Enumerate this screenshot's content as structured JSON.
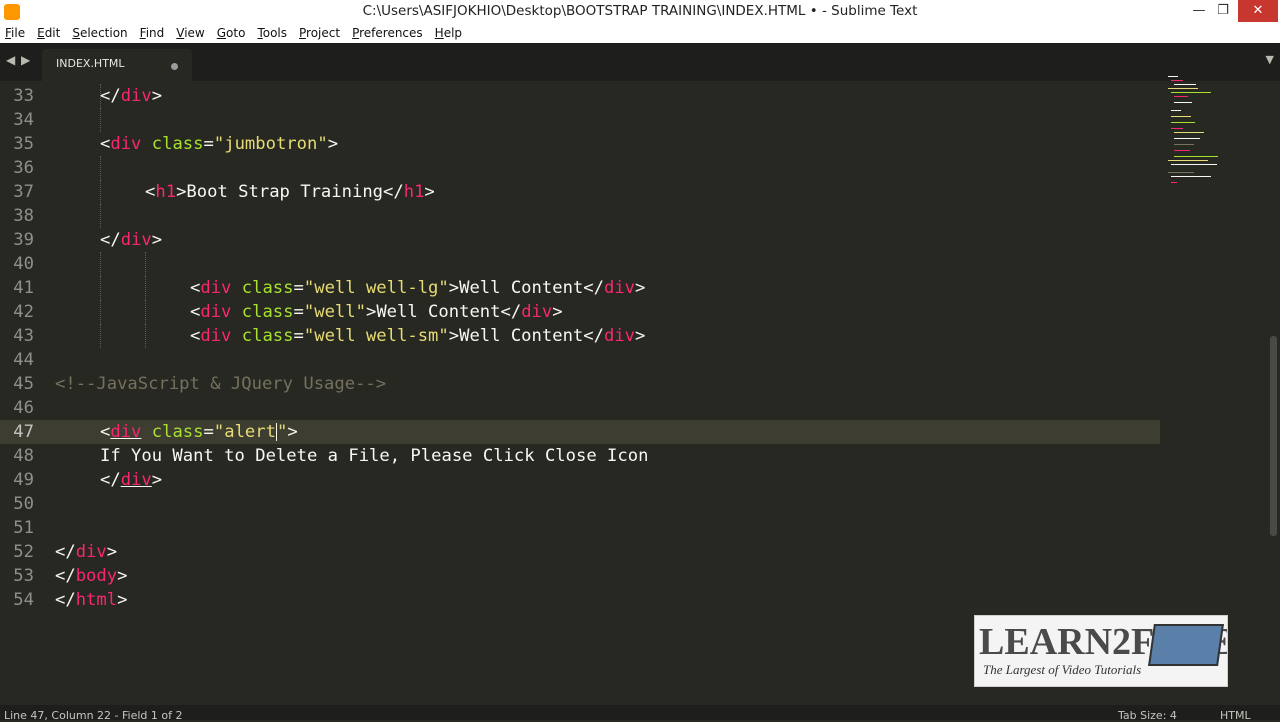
{
  "window": {
    "title": "C:\\Users\\ASIFJOKHIO\\Desktop\\BOOTSTRAP TRAINING\\INDEX.HTML • - Sublime Text",
    "controls": {
      "minimize": "—",
      "maximize": "❐",
      "close": "✕"
    }
  },
  "menu": [
    {
      "ul": "F",
      "rest": "ile"
    },
    {
      "ul": "E",
      "rest": "dit"
    },
    {
      "ul": "S",
      "rest": "election"
    },
    {
      "ul": "F",
      "rest": "ind"
    },
    {
      "ul": "V",
      "rest": "iew"
    },
    {
      "ul": "G",
      "rest": "oto"
    },
    {
      "ul": "T",
      "rest": "ools"
    },
    {
      "ul": "P",
      "rest": "roject"
    },
    {
      "ul": "P",
      "rest": "references"
    },
    {
      "ul": "H",
      "rest": "elp"
    }
  ],
  "tabs": {
    "nav_left": "◀",
    "nav_right": "▶",
    "overflow": "▼",
    "items": [
      {
        "label": "INDEX.HTML",
        "modified": true
      }
    ]
  },
  "editor": {
    "active_line": 47,
    "lines": [
      {
        "n": "33",
        "indent": [
          100
        ],
        "tokens": [
          [
            "p",
            "</"
          ],
          [
            "tag",
            "div"
          ],
          [
            "p",
            ">"
          ]
        ]
      },
      {
        "n": "34",
        "indent": [
          100
        ],
        "tokens": []
      },
      {
        "n": "35",
        "indent": [],
        "tokens": [
          [
            "p",
            "<"
          ],
          [
            "tag",
            "div"
          ],
          [
            "p",
            " "
          ],
          [
            "attr",
            "class"
          ],
          [
            "p",
            "="
          ],
          [
            "str",
            "\"jumbotron\""
          ],
          [
            "p",
            ">"
          ]
        ]
      },
      {
        "n": "36",
        "indent": [
          100
        ],
        "tokens": []
      },
      {
        "n": "37",
        "indent": [
          100
        ],
        "tokens": [
          [
            "p",
            "<"
          ],
          [
            "tag",
            "h1"
          ],
          [
            "p",
            ">Boot Strap Training</"
          ],
          [
            "tag",
            "h1"
          ],
          [
            "p",
            ">"
          ]
        ]
      },
      {
        "n": "38",
        "indent": [
          100
        ],
        "tokens": []
      },
      {
        "n": "39",
        "indent": [],
        "tokens": [
          [
            "p",
            "</"
          ],
          [
            "tag",
            "div"
          ],
          [
            "p",
            ">"
          ]
        ]
      },
      {
        "n": "40",
        "indent": [
          100,
          145
        ],
        "tokens": []
      },
      {
        "n": "41",
        "indent": [
          100,
          145
        ],
        "tokens": [
          [
            "p",
            "<"
          ],
          [
            "tag",
            "div"
          ],
          [
            "p",
            " "
          ],
          [
            "attr",
            "class"
          ],
          [
            "p",
            "="
          ],
          [
            "str",
            "\"well well-lg\""
          ],
          [
            "p",
            ">Well Content</"
          ],
          [
            "tag",
            "div"
          ],
          [
            "p",
            ">"
          ]
        ]
      },
      {
        "n": "42",
        "indent": [
          100,
          145
        ],
        "tokens": [
          [
            "p",
            "<"
          ],
          [
            "tag",
            "div"
          ],
          [
            "p",
            " "
          ],
          [
            "attr",
            "class"
          ],
          [
            "p",
            "="
          ],
          [
            "str",
            "\"well\""
          ],
          [
            "p",
            ">Well Content</"
          ],
          [
            "tag",
            "div"
          ],
          [
            "p",
            ">"
          ]
        ]
      },
      {
        "n": "43",
        "indent": [
          100,
          145
        ],
        "tokens": [
          [
            "p",
            "<"
          ],
          [
            "tag",
            "div"
          ],
          [
            "p",
            " "
          ],
          [
            "attr",
            "class"
          ],
          [
            "p",
            "="
          ],
          [
            "str",
            "\"well well-sm\""
          ],
          [
            "p",
            ">Well Content</"
          ],
          [
            "tag",
            "div"
          ],
          [
            "p",
            ">"
          ]
        ]
      },
      {
        "n": "44",
        "indent": [],
        "tokens": []
      },
      {
        "n": "45",
        "indent": [],
        "tokens": [
          [
            "cm",
            "<!--JavaScript & JQuery Usage-->"
          ]
        ]
      },
      {
        "n": "46",
        "indent": [],
        "tokens": []
      },
      {
        "n": "47",
        "indent": [],
        "tokens": [
          [
            "p",
            "<"
          ],
          [
            "tagu",
            "div"
          ],
          [
            "p",
            " "
          ],
          [
            "attr",
            "class"
          ],
          [
            "p",
            "="
          ],
          [
            "str",
            "\"alert"
          ],
          [
            "caret",
            ""
          ],
          [
            "str",
            "\""
          ],
          [
            "p",
            ">"
          ]
        ]
      },
      {
        "n": "48",
        "indent": [],
        "tokens": [
          [
            "p",
            "If You Want to Delete a File, Please Click Close Icon"
          ]
        ]
      },
      {
        "n": "49",
        "indent": [],
        "tokens": [
          [
            "p",
            "</"
          ],
          [
            "tagu",
            "div"
          ],
          [
            "p",
            ">"
          ]
        ]
      },
      {
        "n": "50",
        "indent": [],
        "tokens": []
      },
      {
        "n": "51",
        "indent": [],
        "tokens": []
      },
      {
        "n": "52",
        "indent": [],
        "tokens": [
          [
            "p",
            "</"
          ],
          [
            "tag",
            "div"
          ],
          [
            "p",
            ">"
          ]
        ]
      },
      {
        "n": "53",
        "indent": [],
        "tokens": [
          [
            "p",
            "</"
          ],
          [
            "tag",
            "body"
          ],
          [
            "p",
            ">"
          ]
        ]
      },
      {
        "n": "54",
        "indent": [],
        "tokens": [
          [
            "p",
            "</"
          ],
          [
            "tag",
            "html"
          ],
          [
            "p",
            ">"
          ]
        ]
      }
    ],
    "code_offsets": {
      "33": 100,
      "35": 100,
      "37": 145,
      "39": 100,
      "41": 190,
      "42": 190,
      "43": 190,
      "45": 55,
      "47": 100,
      "48": 100,
      "49": 100,
      "52": 55,
      "53": 55,
      "54": 55
    }
  },
  "status": {
    "position": "Line 47, Column 22 - Field 1 of 2",
    "tab_size": "Tab Size: 4",
    "syntax": "HTML"
  },
  "watermark": {
    "title": "LEARN2FREE",
    "subtitle": "The Largest of Video Tutorials"
  },
  "colors": {
    "background": "#272822",
    "tag": "#f92672",
    "attribute": "#a6e22e",
    "string": "#e6db74",
    "comment": "#75715e",
    "text": "#f8f8f2"
  }
}
